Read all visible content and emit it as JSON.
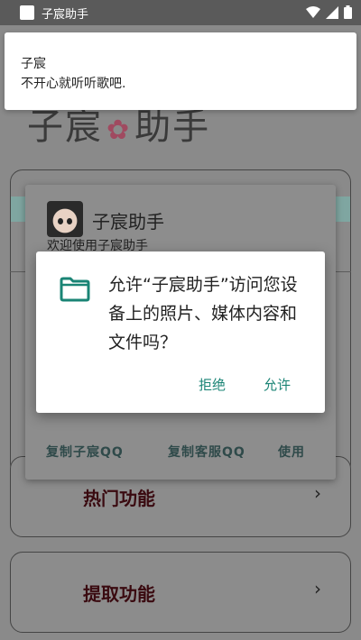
{
  "status_bar": {
    "app_title": "子宸助手"
  },
  "background": {
    "big_title_left": "子宸",
    "big_title_right": "助手",
    "cards": [
      {
        "label": "热门功能"
      },
      {
        "label": "提取功能"
      }
    ]
  },
  "info_dialog": {
    "name": "子宸助手",
    "welcome": "欢迎使用子宸助手",
    "buttons": [
      "复制子宸QQ",
      "复制客服QQ",
      "使用"
    ]
  },
  "permission_dialog": {
    "message": "允许“子宸助手”访问您设备上的照片、媒体内容和文件吗？",
    "deny_label": "拒绝",
    "allow_label": "允许",
    "accent_color": "#1a8475"
  },
  "notification": {
    "title": "子宸",
    "text": "不开心就听听歌吧."
  }
}
